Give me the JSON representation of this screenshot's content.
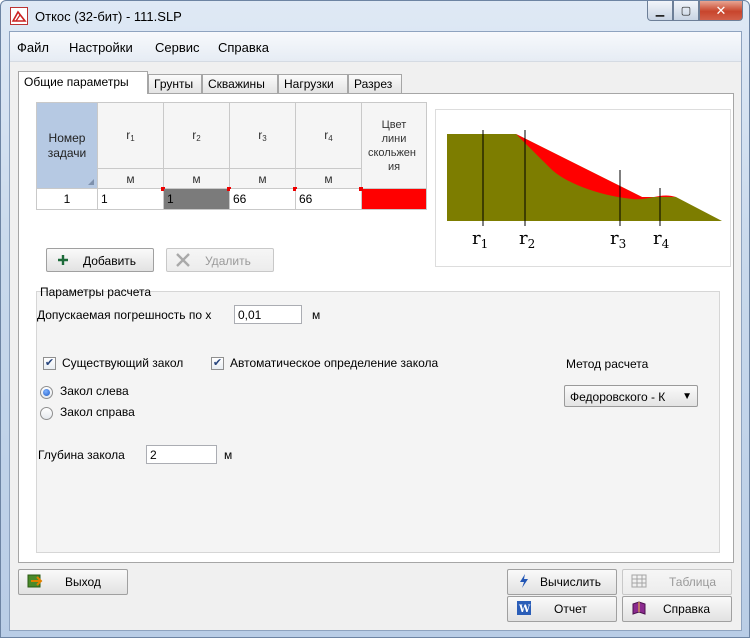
{
  "window": {
    "title": "Откос (32-бит) - 111.SLP",
    "controls": {
      "minimize": "▁",
      "maximize": "▢",
      "close": "✕"
    }
  },
  "menu": [
    "Файл",
    "Настройки",
    "Сервис",
    "Справка"
  ],
  "tabs": [
    "Общие параметры",
    "Грунты",
    "Скважины",
    "Нагрузки",
    "Разрез"
  ],
  "grid": {
    "number_header": [
      "Номер",
      "задачи"
    ],
    "columns": [
      {
        "name": "r",
        "index": "1",
        "unit": "м"
      },
      {
        "name": "r",
        "index": "2",
        "unit": "м"
      },
      {
        "name": "r",
        "index": "3",
        "unit": "м"
      },
      {
        "name": "r",
        "index": "4",
        "unit": "м"
      }
    ],
    "color_header": [
      "Цвет",
      "лини",
      "скольжен",
      "ия"
    ],
    "rows": [
      {
        "number": "1",
        "r1": "1",
        "r2": "1",
        "r3": "66",
        "r4": "66",
        "color": "#ff0000"
      }
    ]
  },
  "diagram": {
    "labels": [
      {
        "letter": "r",
        "index": "1"
      },
      {
        "letter": "r",
        "index": "2"
      },
      {
        "letter": "r",
        "index": "3"
      },
      {
        "letter": "r",
        "index": "4"
      }
    ],
    "colors": {
      "ground": "#7d7d00",
      "sliding_zone": "#ff0000"
    }
  },
  "buttons": {
    "add": "Добавить",
    "delete": "Удалить",
    "exit": "Выход",
    "calculate": "Вычислить",
    "table": "Таблица",
    "report": "Отчет",
    "help": "Справка"
  },
  "params": {
    "group_title": "Параметры расчета",
    "tolerance_label": "Допускаемая погрешность по х",
    "tolerance_value": "0,01",
    "tolerance_unit": "м",
    "existing_cut_label": "Существующий закол",
    "existing_cut_checked": true,
    "auto_detect_label": "Автоматическое определение закола",
    "auto_detect_checked": true,
    "cut_left_label": "Закол слева",
    "cut_right_label": "Закол справа",
    "cut_side_selected": "left",
    "depth_label": "Глубина закола",
    "depth_value": "2",
    "depth_unit": "м",
    "method_label": "Метод расчета",
    "method_value": "Федоровского - К"
  }
}
